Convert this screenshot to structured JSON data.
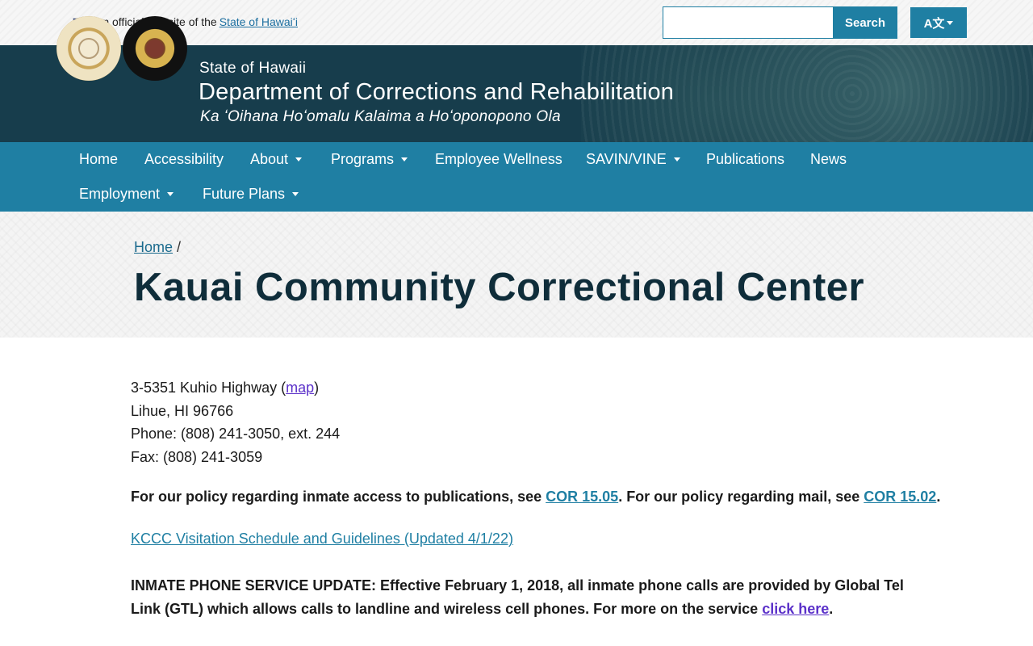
{
  "topbar": {
    "official_prefix": "An official website of the",
    "official_link": "State of Hawaiʻi",
    "search_value": "",
    "search_button": "Search",
    "language_button": "A文"
  },
  "header": {
    "state": "State of Hawaii",
    "department": "Department of Corrections and Rehabilitation",
    "hawaiian_name": "Ka ʻOihana Hoʻomalu Kalaima a Hoʻoponopono Ola"
  },
  "nav": {
    "items": [
      {
        "label": "Home"
      },
      {
        "label": "Accessibility"
      },
      {
        "label": "About"
      },
      {
        "label": "Programs"
      },
      {
        "label": "Employee Wellness"
      },
      {
        "label": "SAVIN/VINE"
      },
      {
        "label": "Publications"
      },
      {
        "label": "News"
      },
      {
        "label": "Employment"
      },
      {
        "label": "Future Plans"
      }
    ]
  },
  "breadcrumb": {
    "home": "Home",
    "separator": "/"
  },
  "page": {
    "title": "Kauai Community Correctional Center"
  },
  "content": {
    "address1_prefix": "3-5351 Kuhio Highway (",
    "map_link": "map",
    "address1_suffix": ")",
    "address2": "Lihue, HI 96766",
    "phone": "Phone: (808) 241-3050, ext. 244",
    "fax": "Fax: (808) 241-3059",
    "policy_pre": "For our policy regarding inmate access to publications, see ",
    "policy_link1": "COR 15.05",
    "policy_mid": ". For our policy regarding mail, see ",
    "policy_link2": "COR 15.02",
    "policy_end": ".",
    "visitation_link": "KCCC Visitation Schedule and Guidelines (Updated 4/1/22)",
    "phone_update_text": "INMATE PHONE SERVICE UPDATE: Effective February 1, 2018, all inmate phone calls are provided by Global Tel Link (GTL) which allows calls to landline and wireless cell phones. For more on the service ",
    "phone_update_link": "click here",
    "phone_update_end": "."
  }
}
